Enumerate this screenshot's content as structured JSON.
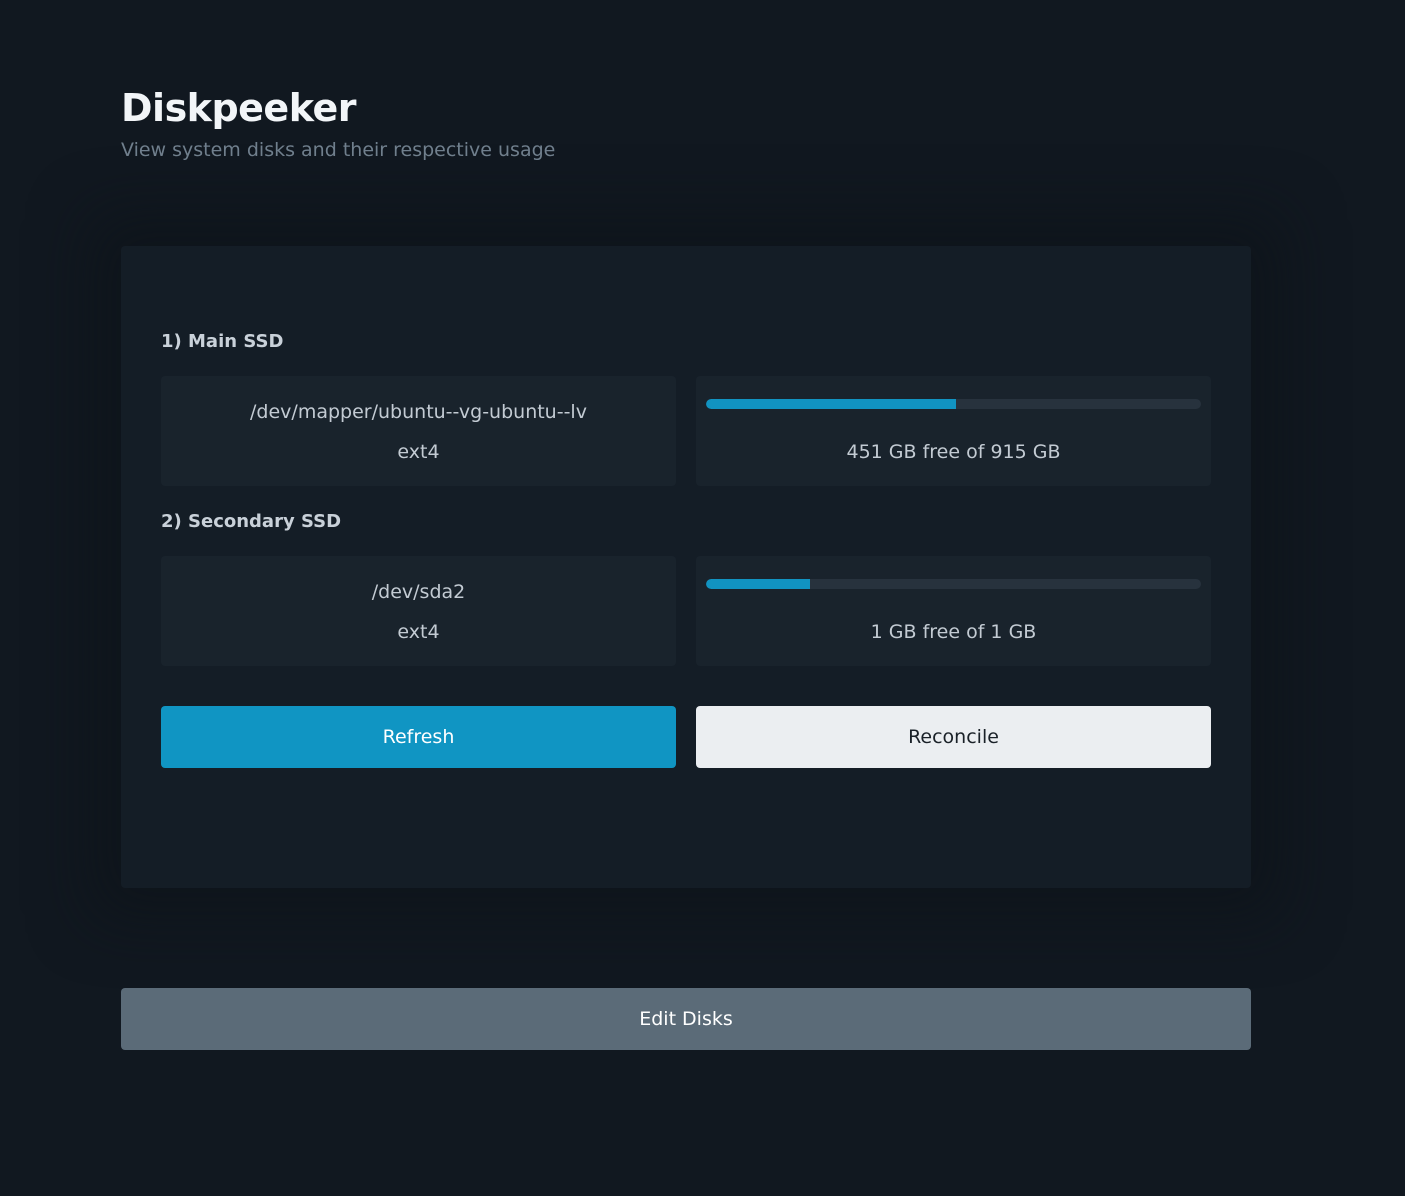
{
  "header": {
    "title": "Diskpeeker",
    "subtitle": "View system disks and their respective usage"
  },
  "disks": [
    {
      "heading": "1) Main SSD",
      "path": "/dev/mapper/ubuntu--vg-ubuntu--lv",
      "fstype": "ext4",
      "usage_text": "451 GB free of 915 GB",
      "bar_fraction": 0.505
    },
    {
      "heading": "2) Secondary SSD",
      "path": "/dev/sda2",
      "fstype": "ext4",
      "usage_text": "1 GB free of 1 GB",
      "bar_fraction": 0.21
    }
  ],
  "actions": {
    "refresh_label": "Refresh",
    "reconcile_label": "Reconcile",
    "edit_label": "Edit Disks"
  },
  "colors": {
    "accent": "#1095c3",
    "background": "#111820",
    "panel": "#141d26",
    "card": "#19232c",
    "edit_button": "#5b6b78",
    "reconcile_button": "#ebeef1"
  }
}
